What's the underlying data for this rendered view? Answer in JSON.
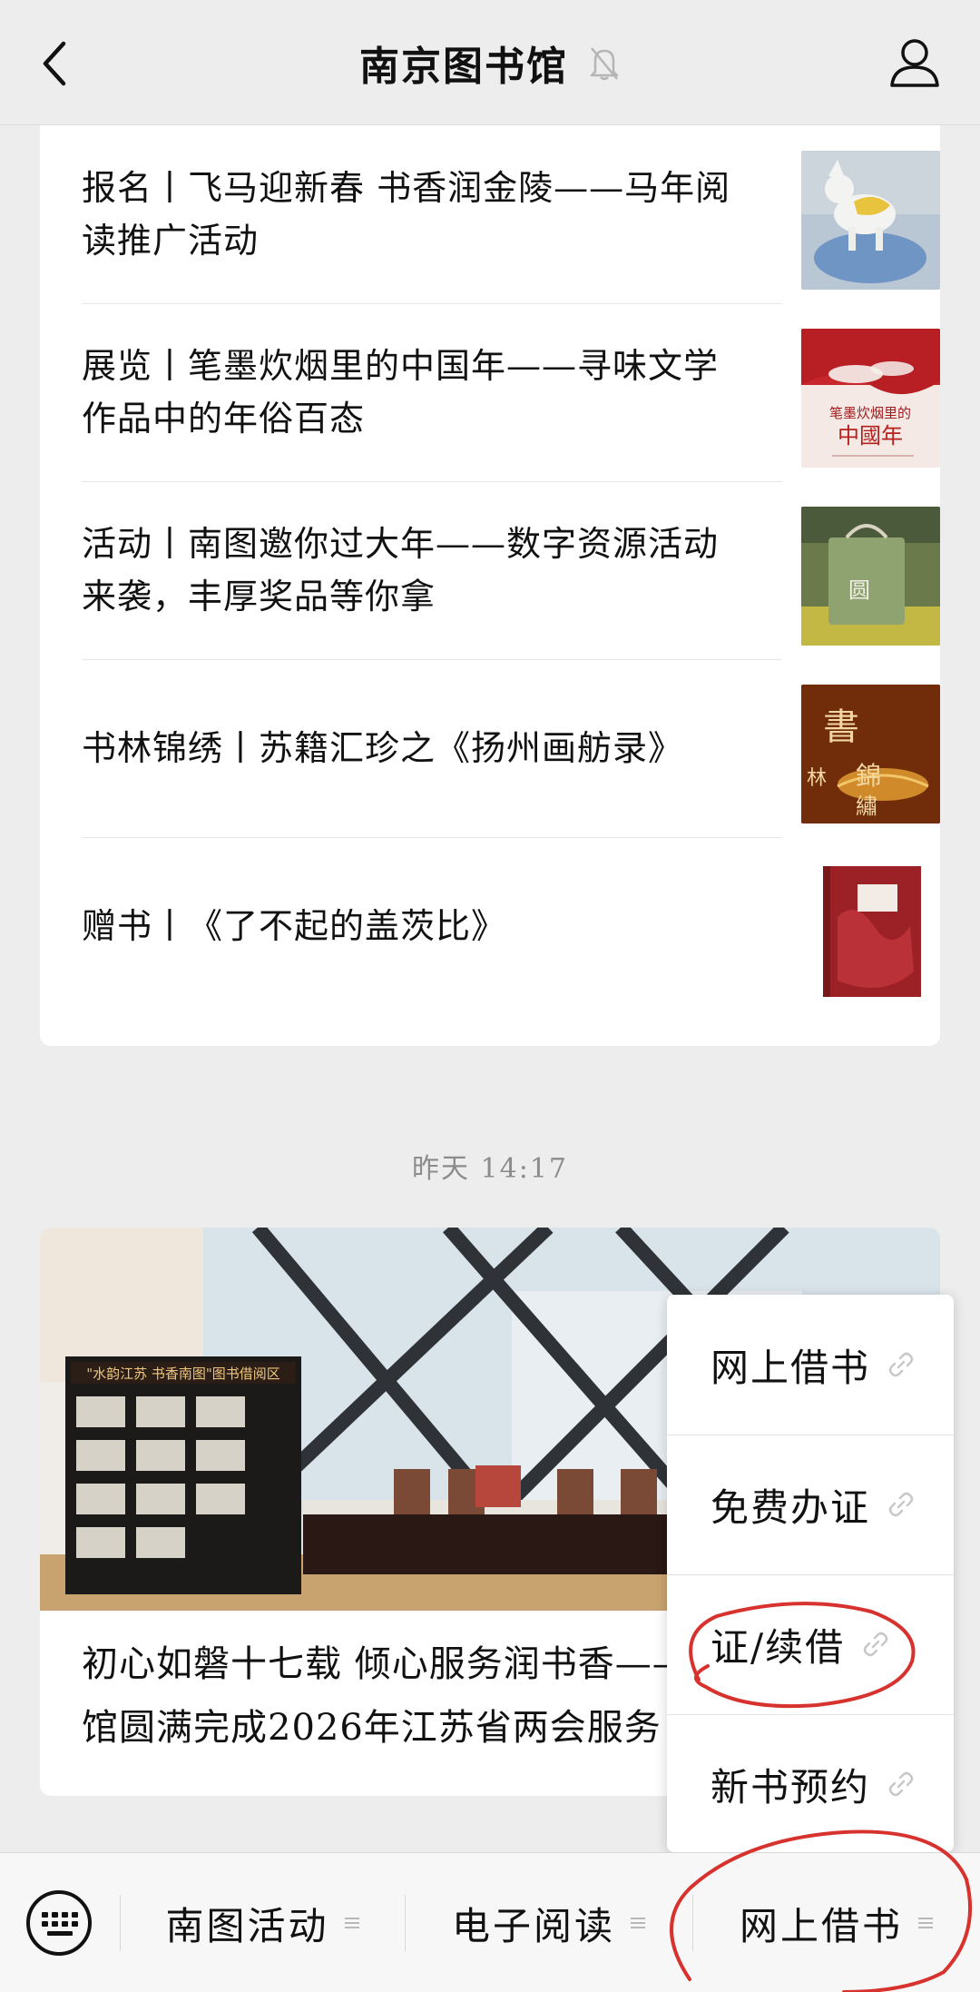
{
  "header": {
    "title": "南京图书馆"
  },
  "articles": [
    {
      "text": "报名丨飞马迎新春 书香润金陵——马年阅读推广活动"
    },
    {
      "text": "展览丨笔墨炊烟里的中国年——寻味文学作品中的年俗百态",
      "thumb_text": "笔墨炊烟里的中國年"
    },
    {
      "text": "活动丨南图邀你过大年——数字资源活动来袭，丰厚奖品等你拿",
      "thumb_text": "圆"
    },
    {
      "text": "书林锦绣丨苏籍汇珍之《扬州画舫录》",
      "thumb_text": "書林錦繡"
    },
    {
      "text": "赠书丨《了不起的盖茨比》"
    }
  ],
  "timestamp": "昨天 14:17",
  "news": {
    "image_banner": "\"水韵江苏 书香南图\"图书借阅区",
    "title_line1": "初心如磐十七载 倾心服务润书香——",
    "title_line2": "馆圆满完成2026年江苏省两会服务"
  },
  "popup_menu": {
    "items": [
      {
        "label": "网上借书"
      },
      {
        "label": "免费办证"
      },
      {
        "label": "证/续借"
      },
      {
        "label": "新书预约"
      }
    ]
  },
  "bottom_bar": {
    "tabs": [
      {
        "label": "南图活动"
      },
      {
        "label": "电子阅读"
      },
      {
        "label": "网上借书"
      }
    ]
  },
  "colors": {
    "background": "#ededed",
    "card": "#ffffff",
    "annotation": "#d7322d"
  },
  "icons": [
    "back-arrow-icon",
    "bell-muted-icon",
    "profile-icon",
    "link-icon",
    "keyboard-icon",
    "menu-lines-icon"
  ]
}
